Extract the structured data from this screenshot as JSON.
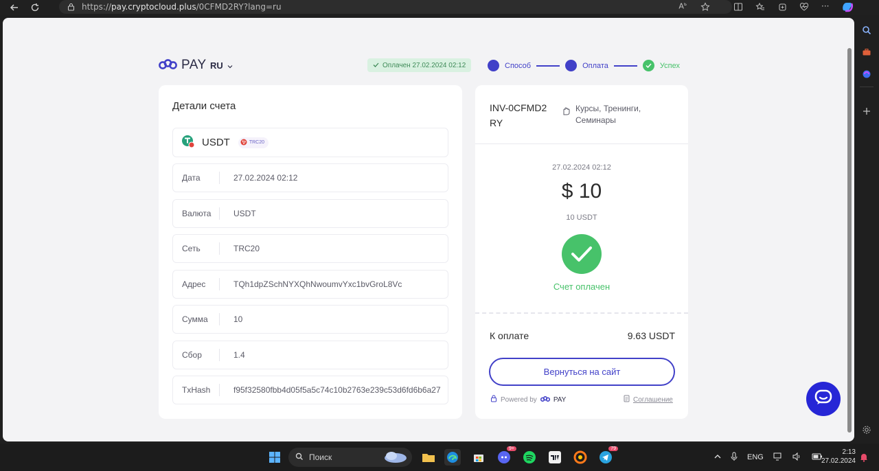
{
  "browser": {
    "url_prefix": "https://",
    "url_domain": "pay.cryptocloud.plus",
    "url_path": "/0CFMD2RY?lang=ru"
  },
  "header": {
    "logo_text": "PAY",
    "lang": "RU",
    "paid_badge": "Оплачен 27.02.2024 02:12",
    "steps": [
      {
        "label": "Способ"
      },
      {
        "label": "Оплата"
      },
      {
        "label": "Успех"
      }
    ]
  },
  "details": {
    "title": "Детали счета",
    "coin": "USDT",
    "network_badge": "TRC20",
    "rows": [
      {
        "key": "Дата",
        "value": "27.02.2024 02:12"
      },
      {
        "key": "Валюта",
        "value": "USDT"
      },
      {
        "key": "Сеть",
        "value": "TRC20"
      },
      {
        "key": "Адрес",
        "value": "TQh1dpZSchNYXQhNwoumvYxc1bvGroL8Vc"
      },
      {
        "key": "Сумма",
        "value": "10"
      },
      {
        "key": "Сбор",
        "value": "1.4"
      },
      {
        "key": "TxHash",
        "value": "f95f32580fbb4d05f5a5c74c10b2763e239c53d6fd6b6a27"
      }
    ]
  },
  "invoice": {
    "id": "INV-0CFMD2RY",
    "category": "Курсы, Тренинги, Семинары",
    "date": "27.02.2024 02:12",
    "amount": "$ 10",
    "amount_crypto": "10 USDT",
    "status": "Счет оплачен",
    "to_pay_label": "К оплате",
    "to_pay_value": "9.63 USDT",
    "back_button": "Вернуться на сайт",
    "powered_by": "Powered by",
    "powered_brand": "PAY",
    "agreement": "Соглашение"
  },
  "taskbar": {
    "search_placeholder": "Поиск",
    "discord_badge": "9+",
    "telegram_badge": "79",
    "lang": "ENG",
    "time": "2:13",
    "date": "27.02.2024"
  },
  "colors": {
    "accent": "#4140c8",
    "success": "#47c26a",
    "chat": "#2626d6"
  }
}
